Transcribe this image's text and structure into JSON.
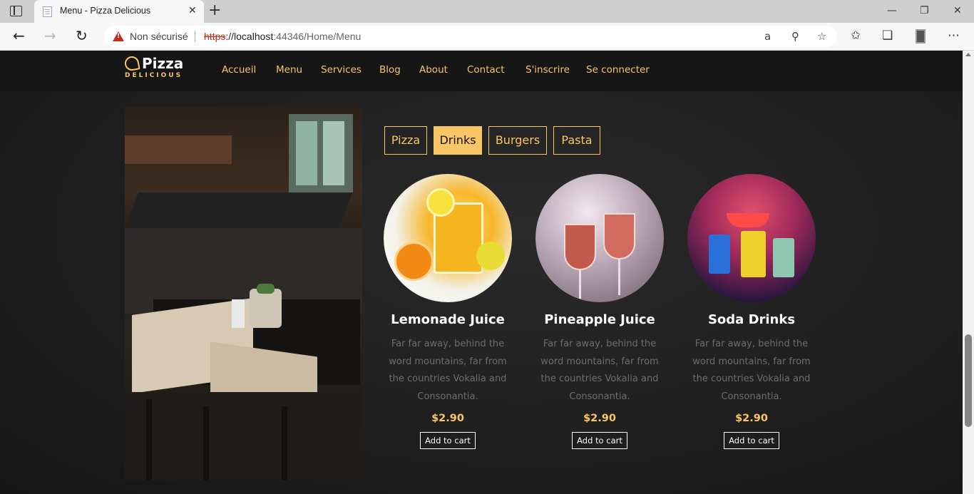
{
  "browser": {
    "tab_title": "Menu - Pizza Delicious",
    "tab_close": "✕",
    "new_tab": "+",
    "window_controls": [
      "—",
      "❐",
      "✕"
    ],
    "not_secure": "Non sécurisé",
    "url_scheme": "https",
    "url_host": "://localhost",
    "url_rest": ":44346/Home/Menu",
    "toolbar_icons": [
      "read-aloud-icon",
      "zoom-icon",
      "add-favorite-icon",
      "favorites-icon",
      "collections-icon",
      "profile-icon",
      "more-icon"
    ]
  },
  "site": {
    "logo_name": "Pizza",
    "logo_sub": "DELICIOUS",
    "nav": [
      "Accueil",
      "Menu",
      "Services",
      "Blog",
      "About",
      "Contact",
      "S'inscrire",
      "Se connecter"
    ],
    "accent": "#fac564"
  },
  "menu": {
    "tabs": [
      {
        "label": "Pizza",
        "active": false
      },
      {
        "label": "Drinks",
        "active": true
      },
      {
        "label": "Burgers",
        "active": false
      },
      {
        "label": "Pasta",
        "active": false
      }
    ],
    "items": [
      {
        "name": "Lemonade Juice",
        "desc": "Far far away, behind the word mountains, far from the countries Vokalia and Consonantia.",
        "price": "$2.90",
        "button": "Add to cart"
      },
      {
        "name": "Pineapple Juice",
        "desc": "Far far away, behind the word mountains, far from the countries Vokalia and Consonantia.",
        "price": "$2.90",
        "button": "Add to cart"
      },
      {
        "name": "Soda Drinks",
        "desc": "Far far away, behind the word mountains, far from the countries Vokalia and Consonantia.",
        "price": "$2.90",
        "button": "Add to cart"
      }
    ]
  }
}
